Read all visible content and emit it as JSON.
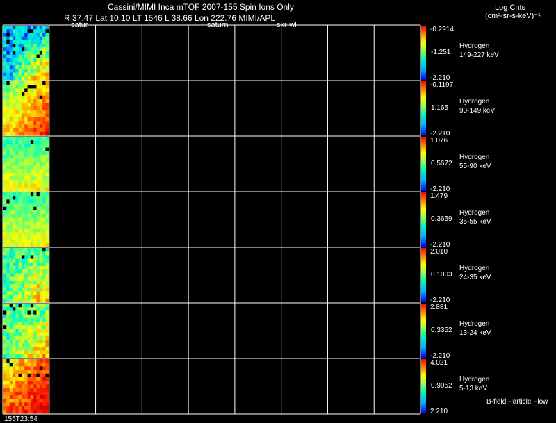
{
  "header": {
    "title": "Cassini/MIMI Inca mTOF  2007-155   Spin    Ions Only",
    "line2": "R         37.47 Lat 10.10 LT 1546 L          38.66 Lon         222.76  MIMI/APL",
    "sub_left": "satur",
    "sub_mid": "saturn",
    "sub_right": "skr-wl",
    "units_title": "Log Cnts",
    "units": "(cm²-sr-s-keV)⁻¹"
  },
  "footer": {
    "time": "155T23:54",
    "bfield": "B-field Particle Flow"
  },
  "colors": {
    "background": "#000000",
    "grid": "#ffffff",
    "colormap": [
      "#0000ff",
      "#00c8ff",
      "#00ffc0",
      "#80ff60",
      "#ffff00",
      "#ff9000",
      "#ff2000",
      "#d00000"
    ]
  },
  "chart_data": {
    "type": "heatmap",
    "grid": true,
    "columns": 9,
    "panels": [
      {
        "species": "Hydrogen",
        "energy": "149-227 keV",
        "cmax": "-0.2914",
        "cmid": "-1.251",
        "cmin": "-2.210",
        "pattern": "sparse"
      },
      {
        "species": "Hydrogen",
        "energy": "90-149 keV",
        "cmax": "-0.1197",
        "cmid": "1.165",
        "cmin": "-2.210",
        "pattern": "gradient"
      },
      {
        "species": "Hydrogen",
        "energy": "55-90 keV",
        "cmax": "1.076",
        "cmid": "0.5672",
        "cmin": "-2.210",
        "pattern": "flat"
      },
      {
        "species": "Hydrogen",
        "energy": "35-55 keV",
        "cmax": "1.479",
        "cmid": "0.3659",
        "cmin": "-2.210",
        "pattern": "flat"
      },
      {
        "species": "Hydrogen",
        "energy": "24-35 keV",
        "cmax": "2.010",
        "cmid": "0.1003",
        "cmin": "-2.210",
        "pattern": "mixed"
      },
      {
        "species": "Hydrogen",
        "energy": "13-24 keV",
        "cmax": "2.881",
        "cmid": "0.3352",
        "cmin": "-2.210",
        "pattern": "mixed"
      },
      {
        "species": "Hydrogen",
        "energy": "5-13 keV",
        "cmax": "4.021",
        "cmid": "0.9052",
        "cmin": "2.210",
        "pattern": "hot"
      }
    ]
  }
}
